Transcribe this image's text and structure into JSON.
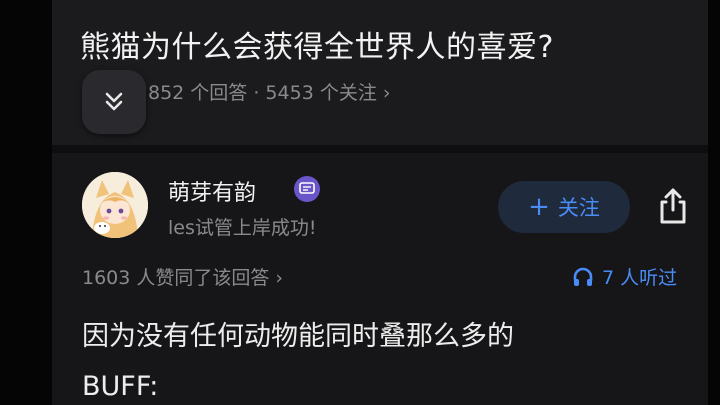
{
  "question": {
    "title": "熊猫为什么会获得全世界人的喜爱?",
    "meta": "852 个回答 · 5453 个关注  ›"
  },
  "answer": {
    "author_name": "萌芽有韵",
    "author_bio": "les试管上岸成功!",
    "follow_label": "关注",
    "follow_plus": "+",
    "stats": "1603 人赞同了该回答  ›",
    "listen": "7 人听过",
    "content_lines": [
      "因为没有任何动物能同时叠那么多的",
      "BUFF:"
    ]
  },
  "icons": {
    "expand": "chevron-double-down-icon",
    "badge": "message-badge-icon",
    "share": "share-icon",
    "listen": "headphones-icon"
  },
  "colors": {
    "accent": "#4a8cf7",
    "background": "#161618",
    "badge": "#6b56c9"
  }
}
